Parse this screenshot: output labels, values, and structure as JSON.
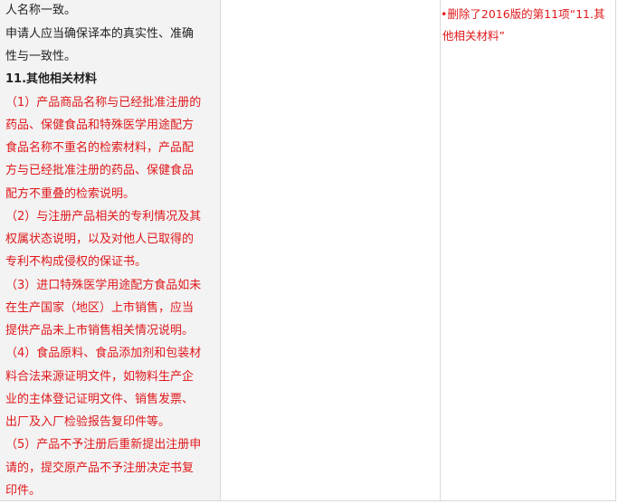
{
  "left_column": {
    "intro_lines": [
      "人名称一致。",
      "申请人应当确保译本的真实性、准确",
      "性与一致性。"
    ],
    "heading": "11.其他相关材料",
    "red_lines": [
      "（1）产品商品名称与已经批准注册的",
      "药品、保健食品和特殊医学用途配方",
      "食品名称不重名的检索材料，产品配",
      "方与已经批准注册的药品、保健食品",
      "配方不重叠的检索说明。",
      "（2）与注册产品相关的专利情况及其",
      "权属状态说明，以及对他人已取得的",
      "专利不构成侵权的保证书。",
      "（3）进口特殊医学用途配方食品如未",
      "在生产国家（地区）上市销售，应当",
      "提供产品未上市销售相关情况说明。",
      "（4）食品原料、食品添加剂和包装材",
      "料合法来源证明文件，如物料生产企",
      "业的主体登记证明文件、销售发票、",
      "出厂及入厂检验报告复印件等。",
      "（5）产品不予注册后重新提出注册申",
      "请的，提交原产品不予注册决定书复",
      "印件。"
    ]
  },
  "right_column": {
    "note_lines": [
      "•删除了2016版的第11项“11.其",
      "他相关材料”"
    ]
  }
}
